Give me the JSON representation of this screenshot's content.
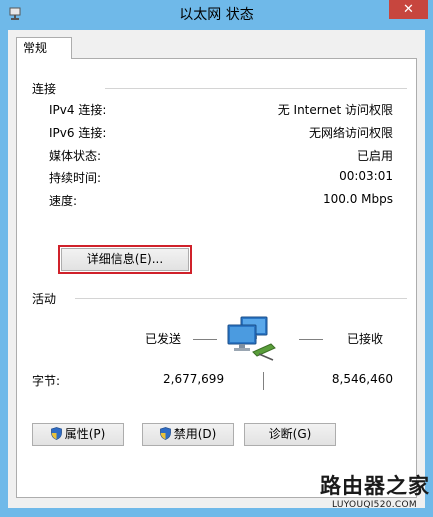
{
  "window": {
    "title": "以太网 状态",
    "close_label": "✕"
  },
  "tabs": [
    {
      "label": "常规"
    }
  ],
  "connection": {
    "group_label": "连接",
    "rows": [
      {
        "label": "IPv4 连接:",
        "value": "无 Internet 访问权限"
      },
      {
        "label": "IPv6 连接:",
        "value": "无网络访问权限"
      },
      {
        "label": "媒体状态:",
        "value": "已启用"
      },
      {
        "label": "持续时间:",
        "value": "00:03:01"
      },
      {
        "label": "速度:",
        "value": "100.0 Mbps"
      }
    ],
    "details_button": "详细信息(E)..."
  },
  "activity": {
    "group_label": "活动",
    "sent_label": "已发送",
    "received_label": "已接收",
    "bytes_label": "字节:",
    "bytes_sent": "2,677,699",
    "bytes_received": "8,546,460"
  },
  "buttons": {
    "properties": "属性(P)",
    "disable": "禁用(D)",
    "diagnose": "诊断(G)"
  },
  "watermark": {
    "chinese": "路由器之家",
    "url": "LUYOUQI520.COM"
  },
  "icons": {
    "app": "network-icon",
    "close": "close-icon",
    "activity": "network-computers-icon",
    "uac": "uac-shield-icon"
  },
  "colors": {
    "frame": "#6fb9e9",
    "close": "#c7463e",
    "highlight": "#d0212a"
  }
}
